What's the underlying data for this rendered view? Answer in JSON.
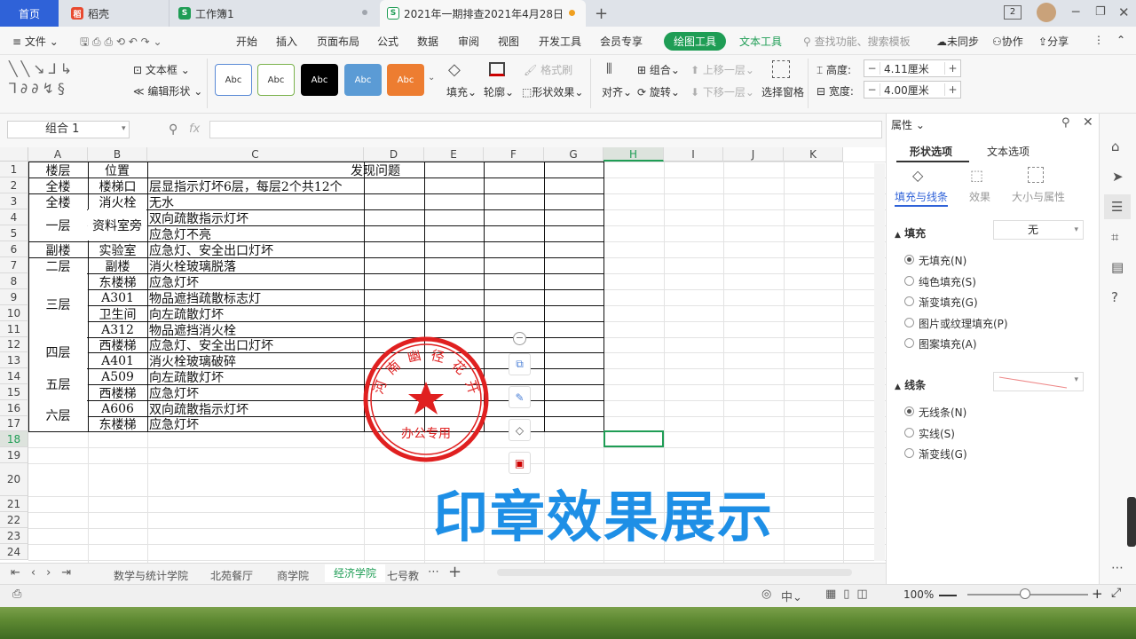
{
  "tabs": {
    "home": "首页",
    "daoke": "稻壳",
    "workbook1": "工作簿1",
    "active": "2021年一期排查2021年4月28日"
  },
  "titlebar": {
    "badge": "2"
  },
  "menu": {
    "file": "文件",
    "items": [
      "开始",
      "插入",
      "页面布局",
      "公式",
      "数据",
      "审阅",
      "视图",
      "开发工具",
      "会员专享"
    ],
    "drawing_tools": "绘图工具",
    "text_tools": "文本工具",
    "search": "查找功能、搜索模板",
    "unsynced": "未同步",
    "collab": "协作",
    "share": "分享"
  },
  "ribbon": {
    "textbox": "文本框",
    "edit_shape": "编辑形状",
    "style_label": "Abc",
    "fill": "填充",
    "outline": "轮廓",
    "format_brush": "格式刷",
    "shape_effect": "形状效果",
    "align": "对齐",
    "group": "组合",
    "rotate": "旋转",
    "bring_forward": "上移一层",
    "send_backward": "下移一层",
    "selection_pane": "选择窗格",
    "height_label": "高度:",
    "height_value": "4.11厘米",
    "width_label": "宽度:",
    "width_value": "4.00厘米"
  },
  "formula": {
    "name_box": "组合 1",
    "fx": "fx"
  },
  "columns": [
    "A",
    "B",
    "C",
    "D",
    "E",
    "F",
    "G",
    "H",
    "I",
    "J",
    "K"
  ],
  "rows": [
    "1",
    "2",
    "3",
    "4",
    "5",
    "6",
    "7",
    "8",
    "9",
    "10",
    "11",
    "12",
    "13",
    "14",
    "15",
    "16",
    "17",
    "18",
    "19",
    "20",
    "21",
    "22",
    "23",
    "24"
  ],
  "table": {
    "header": {
      "floor": "楼层",
      "location": "位置",
      "issue": "发现问题"
    },
    "cells": [
      {
        "r": 2,
        "a": "全楼",
        "b": "楼梯口",
        "c": "层显指示灯坏6层，每层2个共12个"
      },
      {
        "r": 3,
        "a": "全楼",
        "b": "消火栓",
        "c": "无水"
      },
      {
        "r": 4,
        "c": "双向疏散指示灯坏"
      },
      {
        "r": 5,
        "c": "应急灯不亮"
      },
      {
        "r": 6,
        "a": "副楼",
        "b": "实验室",
        "c": "应急灯、安全出口灯坏"
      },
      {
        "r": 7,
        "a": "二层",
        "b": "副楼",
        "c": "消火栓玻璃脱落"
      },
      {
        "r": 8,
        "b": "东楼梯",
        "c": "应急灯坏"
      },
      {
        "r": 9,
        "b": "A301",
        "c": "物品遮挡疏散标志灯"
      },
      {
        "r": 10,
        "b": "卫生间",
        "c": "向左疏散灯坏"
      },
      {
        "r": 11,
        "b": "A312",
        "c": "物品遮挡消火栓"
      },
      {
        "r": 12,
        "b": "西楼梯",
        "c": "应急灯、安全出口灯坏"
      },
      {
        "r": 13,
        "b": "A401",
        "c": "消火栓玻璃破碎"
      },
      {
        "r": 14,
        "b": "A509",
        "c": "向左疏散灯坏"
      },
      {
        "r": 15,
        "b": "西楼梯",
        "c": "应急灯坏"
      },
      {
        "r": 16,
        "b": "A606",
        "c": "双向疏散指示灯坏"
      },
      {
        "r": 17,
        "b": "东楼梯",
        "c": "应急灯坏"
      }
    ],
    "merged": {
      "lounge": "资料室旁",
      "f1": "一层",
      "f3": "三层",
      "f4": "四层",
      "f5": "五层",
      "f6": "六层"
    }
  },
  "stamp": {
    "arc_text": [
      "河",
      "南",
      "幽",
      "径",
      "花",
      "开"
    ],
    "bottom": "办公专用",
    "color": "#e02020"
  },
  "overlay_caption": "印章效果展示",
  "sheets": [
    "数学与统计学院",
    "北苑餐厅",
    "商学院",
    "经济学院",
    "七号教"
  ],
  "status": {
    "zoom": "100%"
  },
  "panel": {
    "title": "属性",
    "tab_shape": "形状选项",
    "tab_text": "文本选项",
    "sub_fill_line": "填充与线条",
    "sub_effect": "效果",
    "sub_size": "大小与属性",
    "fill_section": "填充",
    "fill_value": "无",
    "fill_options": [
      "无填充(N)",
      "纯色填充(S)",
      "渐变填充(G)",
      "图片或纹理填充(P)",
      "图案填充(A)"
    ],
    "line_section": "线条",
    "line_options": [
      "无线条(N)",
      "实线(S)",
      "渐变线(G)"
    ]
  },
  "colors": {
    "accent": "#1f9d55",
    "tab_blue": "#2f62d8",
    "caption": "#1e8fe6"
  }
}
